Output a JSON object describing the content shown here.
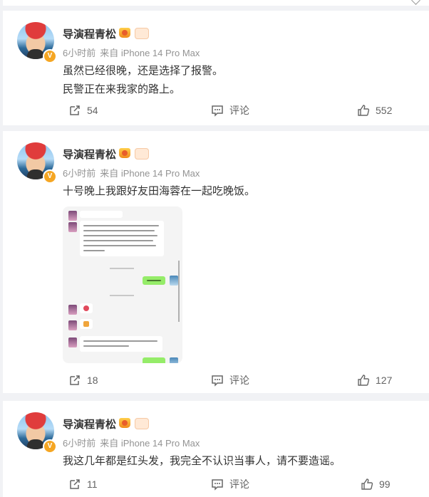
{
  "posts": [
    {
      "username": "导演程青松",
      "time": "6小时前",
      "source": "来自 iPhone 14 Pro Max",
      "lines": [
        "虽然已经很晚，还是选择了报警。",
        "民警正在来我家的路上。"
      ],
      "reposts": "54",
      "comment_label": "评论",
      "likes": "552"
    },
    {
      "username": "导演程青松",
      "time": "6小时前",
      "source": "来自 iPhone 14 Pro Max",
      "lines": [
        "十号晚上我跟好友田海蓉在一起吃晚饭。"
      ],
      "reposts": "18",
      "comment_label": "评论",
      "likes": "127"
    },
    {
      "username": "导演程青松",
      "time": "6小时前",
      "source": "来自 iPhone 14 Pro Max",
      "lines": [
        "我这几年都是红头发，我完全不认识当事人，请不要造谣。"
      ],
      "reposts": "11",
      "comment_label": "评论",
      "likes": "99"
    }
  ],
  "badge": "V",
  "colors": {
    "page_bg": "#f1f2f5",
    "card_bg": "#ffffff",
    "name": "#333333",
    "meta": "#939393",
    "verified": "#f5a623"
  }
}
